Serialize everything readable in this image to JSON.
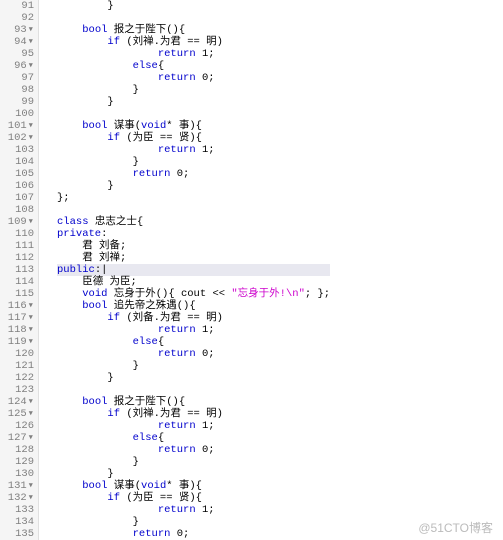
{
  "watermark": "@51CTO博客",
  "gutter": [
    {
      "n": "91",
      "f": ""
    },
    {
      "n": "92",
      "f": ""
    },
    {
      "n": "93",
      "f": "▾"
    },
    {
      "n": "94",
      "f": "▾"
    },
    {
      "n": "95",
      "f": ""
    },
    {
      "n": "96",
      "f": "▾"
    },
    {
      "n": "97",
      "f": ""
    },
    {
      "n": "98",
      "f": ""
    },
    {
      "n": "99",
      "f": ""
    },
    {
      "n": "100",
      "f": ""
    },
    {
      "n": "101",
      "f": "▾"
    },
    {
      "n": "102",
      "f": "▾"
    },
    {
      "n": "103",
      "f": ""
    },
    {
      "n": "104",
      "f": ""
    },
    {
      "n": "105",
      "f": ""
    },
    {
      "n": "106",
      "f": ""
    },
    {
      "n": "107",
      "f": ""
    },
    {
      "n": "108",
      "f": ""
    },
    {
      "n": "109",
      "f": "▾"
    },
    {
      "n": "110",
      "f": ""
    },
    {
      "n": "111",
      "f": ""
    },
    {
      "n": "112",
      "f": ""
    },
    {
      "n": "113",
      "f": ""
    },
    {
      "n": "114",
      "f": ""
    },
    {
      "n": "115",
      "f": ""
    },
    {
      "n": "116",
      "f": "▾"
    },
    {
      "n": "117",
      "f": "▾"
    },
    {
      "n": "118",
      "f": "▾"
    },
    {
      "n": "119",
      "f": "▾"
    },
    {
      "n": "120",
      "f": ""
    },
    {
      "n": "121",
      "f": ""
    },
    {
      "n": "122",
      "f": ""
    },
    {
      "n": "123",
      "f": ""
    },
    {
      "n": "124",
      "f": "▾"
    },
    {
      "n": "125",
      "f": "▾"
    },
    {
      "n": "126",
      "f": ""
    },
    {
      "n": "127",
      "f": "▾"
    },
    {
      "n": "128",
      "f": ""
    },
    {
      "n": "129",
      "f": ""
    },
    {
      "n": "130",
      "f": ""
    },
    {
      "n": "131",
      "f": "▾"
    },
    {
      "n": "132",
      "f": "▾"
    },
    {
      "n": "133",
      "f": ""
    },
    {
      "n": "134",
      "f": ""
    },
    {
      "n": "135",
      "f": ""
    }
  ],
  "code": [
    {
      "hl": false,
      "s": [
        {
          "c": "",
          "t": "        }"
        }
      ]
    },
    {
      "hl": false,
      "s": []
    },
    {
      "hl": false,
      "s": [
        {
          "c": "",
          "t": "    "
        },
        {
          "c": "kw",
          "t": "bool"
        },
        {
          "c": "",
          "t": " 报之于陛下(){"
        }
      ]
    },
    {
      "hl": false,
      "s": [
        {
          "c": "",
          "t": "        "
        },
        {
          "c": "kw",
          "t": "if"
        },
        {
          "c": "",
          "t": " (刘禅.为君 == 明)"
        }
      ]
    },
    {
      "hl": false,
      "s": [
        {
          "c": "",
          "t": "                "
        },
        {
          "c": "kw",
          "t": "return"
        },
        {
          "c": "",
          "t": " 1;"
        }
      ]
    },
    {
      "hl": false,
      "s": [
        {
          "c": "",
          "t": "            "
        },
        {
          "c": "kw",
          "t": "else"
        },
        {
          "c": "",
          "t": "{"
        }
      ]
    },
    {
      "hl": false,
      "s": [
        {
          "c": "",
          "t": "                "
        },
        {
          "c": "kw",
          "t": "return"
        },
        {
          "c": "",
          "t": " 0;"
        }
      ]
    },
    {
      "hl": false,
      "s": [
        {
          "c": "",
          "t": "            }"
        }
      ]
    },
    {
      "hl": false,
      "s": [
        {
          "c": "",
          "t": "        }"
        }
      ]
    },
    {
      "hl": false,
      "s": []
    },
    {
      "hl": false,
      "s": [
        {
          "c": "",
          "t": "    "
        },
        {
          "c": "kw",
          "t": "bool"
        },
        {
          "c": "",
          "t": " 谋事("
        },
        {
          "c": "kw",
          "t": "void"
        },
        {
          "c": "",
          "t": "* 事){"
        }
      ]
    },
    {
      "hl": false,
      "s": [
        {
          "c": "",
          "t": "        "
        },
        {
          "c": "kw",
          "t": "if"
        },
        {
          "c": "",
          "t": " (为臣 == 贤){"
        }
      ]
    },
    {
      "hl": false,
      "s": [
        {
          "c": "",
          "t": "                "
        },
        {
          "c": "kw",
          "t": "return"
        },
        {
          "c": "",
          "t": " 1;"
        }
      ]
    },
    {
      "hl": false,
      "s": [
        {
          "c": "",
          "t": "            }"
        }
      ]
    },
    {
      "hl": false,
      "s": [
        {
          "c": "",
          "t": "            "
        },
        {
          "c": "kw",
          "t": "return"
        },
        {
          "c": "",
          "t": " 0;"
        }
      ]
    },
    {
      "hl": false,
      "s": [
        {
          "c": "",
          "t": "        }"
        }
      ]
    },
    {
      "hl": false,
      "s": [
        {
          "c": "",
          "t": "};"
        }
      ]
    },
    {
      "hl": false,
      "s": []
    },
    {
      "hl": false,
      "s": [
        {
          "c": "kw",
          "t": "class"
        },
        {
          "c": "",
          "t": " 忠志之士{"
        }
      ]
    },
    {
      "hl": false,
      "s": [
        {
          "c": "kw",
          "t": "private"
        },
        {
          "c": "",
          "t": ":"
        }
      ]
    },
    {
      "hl": false,
      "s": [
        {
          "c": "",
          "t": "    君 刘备;"
        }
      ]
    },
    {
      "hl": false,
      "s": [
        {
          "c": "",
          "t": "    君 刘禅;"
        }
      ]
    },
    {
      "hl": true,
      "s": [
        {
          "c": "kw",
          "t": "public"
        },
        {
          "c": "",
          "t": ":|"
        }
      ]
    },
    {
      "hl": false,
      "s": [
        {
          "c": "",
          "t": "    臣德 为臣;"
        }
      ]
    },
    {
      "hl": false,
      "s": [
        {
          "c": "",
          "t": "    "
        },
        {
          "c": "kw",
          "t": "void"
        },
        {
          "c": "",
          "t": " 忘身于外(){ cout << "
        },
        {
          "c": "str",
          "t": "\"忘身于外!\\n\""
        },
        {
          "c": "",
          "t": "; };"
        }
      ]
    },
    {
      "hl": false,
      "s": [
        {
          "c": "",
          "t": "    "
        },
        {
          "c": "kw",
          "t": "bool"
        },
        {
          "c": "",
          "t": " 追先帝之殊遇(){"
        }
      ]
    },
    {
      "hl": false,
      "s": [
        {
          "c": "",
          "t": "        "
        },
        {
          "c": "kw",
          "t": "if"
        },
        {
          "c": "",
          "t": " (刘备.为君 == 明)"
        }
      ]
    },
    {
      "hl": false,
      "s": [
        {
          "c": "",
          "t": "                "
        },
        {
          "c": "kw",
          "t": "return"
        },
        {
          "c": "",
          "t": " 1;"
        }
      ]
    },
    {
      "hl": false,
      "s": [
        {
          "c": "",
          "t": "            "
        },
        {
          "c": "kw",
          "t": "else"
        },
        {
          "c": "",
          "t": "{"
        }
      ]
    },
    {
      "hl": false,
      "s": [
        {
          "c": "",
          "t": "                "
        },
        {
          "c": "kw",
          "t": "return"
        },
        {
          "c": "",
          "t": " 0;"
        }
      ]
    },
    {
      "hl": false,
      "s": [
        {
          "c": "",
          "t": "            }"
        }
      ]
    },
    {
      "hl": false,
      "s": [
        {
          "c": "",
          "t": "        }"
        }
      ]
    },
    {
      "hl": false,
      "s": []
    },
    {
      "hl": false,
      "s": [
        {
          "c": "",
          "t": "    "
        },
        {
          "c": "kw",
          "t": "bool"
        },
        {
          "c": "",
          "t": " 报之于陛下(){"
        }
      ]
    },
    {
      "hl": false,
      "s": [
        {
          "c": "",
          "t": "        "
        },
        {
          "c": "kw",
          "t": "if"
        },
        {
          "c": "",
          "t": " (刘禅.为君 == 明)"
        }
      ]
    },
    {
      "hl": false,
      "s": [
        {
          "c": "",
          "t": "                "
        },
        {
          "c": "kw",
          "t": "return"
        },
        {
          "c": "",
          "t": " 1;"
        }
      ]
    },
    {
      "hl": false,
      "s": [
        {
          "c": "",
          "t": "            "
        },
        {
          "c": "kw",
          "t": "else"
        },
        {
          "c": "",
          "t": "{"
        }
      ]
    },
    {
      "hl": false,
      "s": [
        {
          "c": "",
          "t": "                "
        },
        {
          "c": "kw",
          "t": "return"
        },
        {
          "c": "",
          "t": " 0;"
        }
      ]
    },
    {
      "hl": false,
      "s": [
        {
          "c": "",
          "t": "            }"
        }
      ]
    },
    {
      "hl": false,
      "s": [
        {
          "c": "",
          "t": "        }"
        }
      ]
    },
    {
      "hl": false,
      "s": [
        {
          "c": "",
          "t": "    "
        },
        {
          "c": "kw",
          "t": "bool"
        },
        {
          "c": "",
          "t": " 谋事("
        },
        {
          "c": "kw",
          "t": "void"
        },
        {
          "c": "",
          "t": "* 事){"
        }
      ]
    },
    {
      "hl": false,
      "s": [
        {
          "c": "",
          "t": "        "
        },
        {
          "c": "kw",
          "t": "if"
        },
        {
          "c": "",
          "t": " (为臣 == 贤){"
        }
      ]
    },
    {
      "hl": false,
      "s": [
        {
          "c": "",
          "t": "                "
        },
        {
          "c": "kw",
          "t": "return"
        },
        {
          "c": "",
          "t": " 1;"
        }
      ]
    },
    {
      "hl": false,
      "s": [
        {
          "c": "",
          "t": "            }"
        }
      ]
    },
    {
      "hl": false,
      "s": [
        {
          "c": "",
          "t": "            "
        },
        {
          "c": "kw",
          "t": "return"
        },
        {
          "c": "",
          "t": " 0;"
        }
      ]
    }
  ]
}
